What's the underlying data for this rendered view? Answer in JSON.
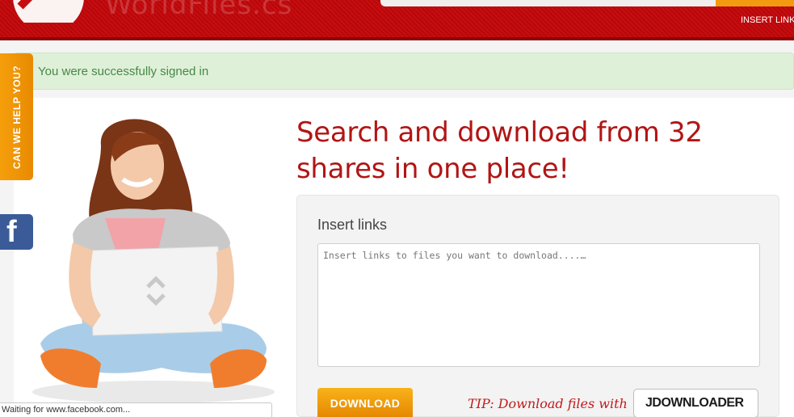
{
  "header": {
    "logo_text": "WorldFiles.cs",
    "nav_insert_links": "INSERT LINKS"
  },
  "alert": {
    "message": "You were successfully signed in"
  },
  "side_tabs": {
    "help_label": "CAN WE HELP YOU?",
    "facebook_label": "f"
  },
  "main": {
    "headline": "Search and download from 32 shares in one place!",
    "panel_title": "Insert links",
    "links_placeholder": "Insert links to files you want to download....…",
    "download_label": "DOWNLOAD",
    "tip_text": "TIP: Download files with",
    "jdownloader_label": "JDOWNLOADER"
  },
  "status_bar": {
    "text": "Waiting for www.facebook.com..."
  },
  "colors": {
    "header_red": "#c70d10",
    "accent_orange": "#f29b10",
    "headline_red": "#b11515",
    "alert_green_bg": "#dff0d8",
    "alert_green_text": "#468847",
    "facebook_blue": "#3b5b98"
  }
}
